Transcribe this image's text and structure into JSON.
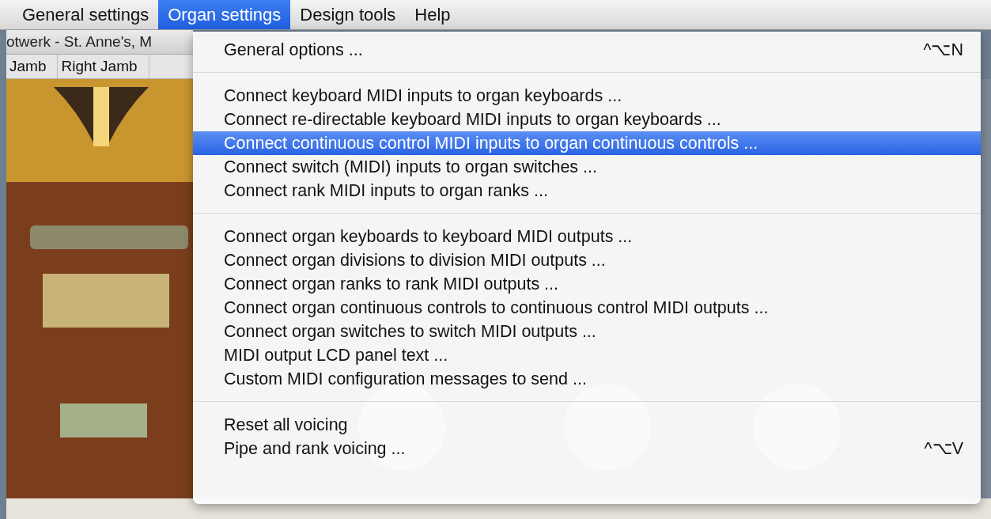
{
  "menu_bar": [
    {
      "label": "General settings",
      "selected": false
    },
    {
      "label": "Organ settings",
      "selected": true
    },
    {
      "label": "Design tools",
      "selected": false
    },
    {
      "label": "Help",
      "selected": false
    }
  ],
  "window": {
    "title": "otwerk - St. Anne's, M"
  },
  "tabs": [
    {
      "label": "Jamb",
      "selected": false
    },
    {
      "label": "Right Jamb",
      "selected": false
    }
  ],
  "menu": {
    "items": [
      {
        "kind": "item",
        "label": "General options ...",
        "shortcut": "^⌥N",
        "selected": false
      },
      {
        "kind": "separator"
      },
      {
        "kind": "item",
        "label": "Connect keyboard MIDI inputs to organ keyboards ...",
        "selected": false
      },
      {
        "kind": "item",
        "label": "Connect re-directable keyboard MIDI inputs to organ keyboards ...",
        "selected": false
      },
      {
        "kind": "item",
        "label": "Connect continuous control MIDI inputs to organ continuous controls ...",
        "selected": true
      },
      {
        "kind": "item",
        "label": "Connect switch (MIDI) inputs to organ switches ...",
        "selected": false
      },
      {
        "kind": "item",
        "label": "Connect rank MIDI inputs to organ ranks ...",
        "selected": false
      },
      {
        "kind": "separator"
      },
      {
        "kind": "item",
        "label": "Connect organ keyboards to keyboard MIDI outputs ...",
        "selected": false
      },
      {
        "kind": "item",
        "label": "Connect organ divisions to division MIDI outputs ...",
        "selected": false
      },
      {
        "kind": "item",
        "label": "Connect organ ranks to rank MIDI outputs ...",
        "selected": false
      },
      {
        "kind": "item",
        "label": "Connect organ continuous controls to continuous control MIDI outputs ...",
        "selected": false
      },
      {
        "kind": "item",
        "label": "Connect organ switches to switch MIDI outputs ...",
        "selected": false
      },
      {
        "kind": "item",
        "label": "MIDI output LCD panel text ...",
        "selected": false
      },
      {
        "kind": "item",
        "label": "Custom MIDI configuration messages to send ...",
        "selected": false
      },
      {
        "kind": "separator"
      },
      {
        "kind": "item",
        "label": "Reset all voicing",
        "selected": false
      },
      {
        "kind": "item",
        "label": "Pipe and rank voicing ...",
        "shortcut": "^⌥V",
        "selected": false
      }
    ]
  }
}
